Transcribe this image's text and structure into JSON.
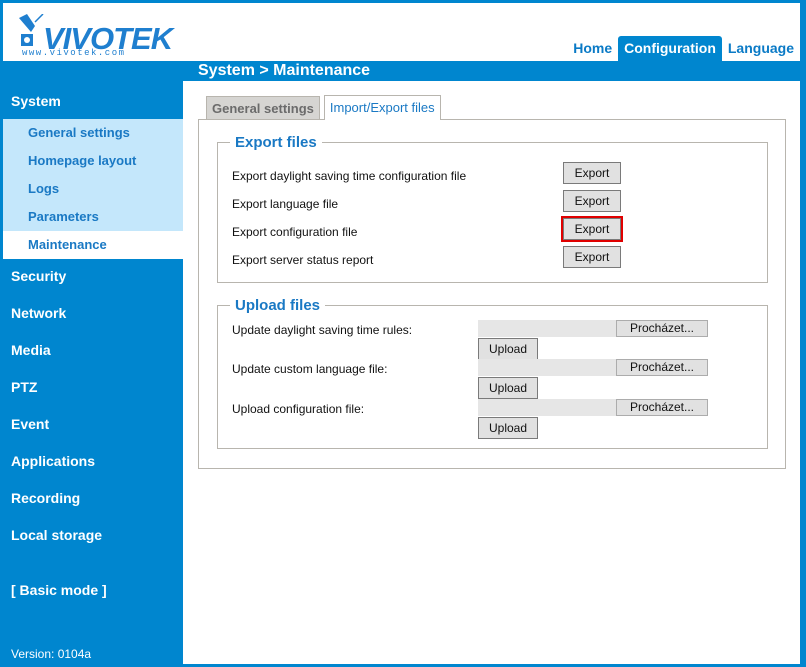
{
  "brand": {
    "name": "VIVOTEK",
    "url_text": "www.vivotek.com"
  },
  "top_nav": {
    "items": [
      {
        "label": "Home",
        "active": false
      },
      {
        "label": "Configuration",
        "active": true
      },
      {
        "label": "Language",
        "active": false
      }
    ]
  },
  "breadcrumb": "System  > Maintenance",
  "sidebar": {
    "system": {
      "label": "System",
      "items": [
        {
          "label": "General settings",
          "active": false
        },
        {
          "label": "Homepage layout",
          "active": false
        },
        {
          "label": "Logs",
          "active": false
        },
        {
          "label": "Parameters",
          "active": false
        },
        {
          "label": "Maintenance",
          "active": true
        }
      ]
    },
    "sections": [
      "Security",
      "Network",
      "Media",
      "PTZ",
      "Event",
      "Applications",
      "Recording",
      "Local storage"
    ],
    "basic_mode": "[ Basic mode ]",
    "version": "Version: 0104a"
  },
  "tabs": [
    {
      "label": "General settings",
      "active": false
    },
    {
      "label": "Import/Export files",
      "active": true
    }
  ],
  "export_files": {
    "legend": "Export files",
    "rows": [
      {
        "label": "Export daylight saving time configuration file",
        "button": "Export",
        "highlighted": false
      },
      {
        "label": "Export language file",
        "button": "Export",
        "highlighted": false
      },
      {
        "label": "Export configuration file",
        "button": "Export",
        "highlighted": true
      },
      {
        "label": "Export server status report",
        "button": "Export",
        "highlighted": false
      }
    ]
  },
  "upload_files": {
    "legend": "Upload files",
    "rows": [
      {
        "label": "Update daylight saving time rules:",
        "file_value": "",
        "browse": "Procházet...",
        "button": "Upload"
      },
      {
        "label": "Update custom language file:",
        "file_value": "",
        "browse": "Procházet...",
        "button": "Upload"
      },
      {
        "label": "Upload configuration file:",
        "file_value": "",
        "browse": "Procházet...",
        "button": "Upload"
      }
    ]
  },
  "colors": {
    "brand_blue": "#0086cf",
    "submenu_bg": "#c4e7fb",
    "link_blue": "#1a79c4",
    "highlight_red": "#e00000"
  }
}
